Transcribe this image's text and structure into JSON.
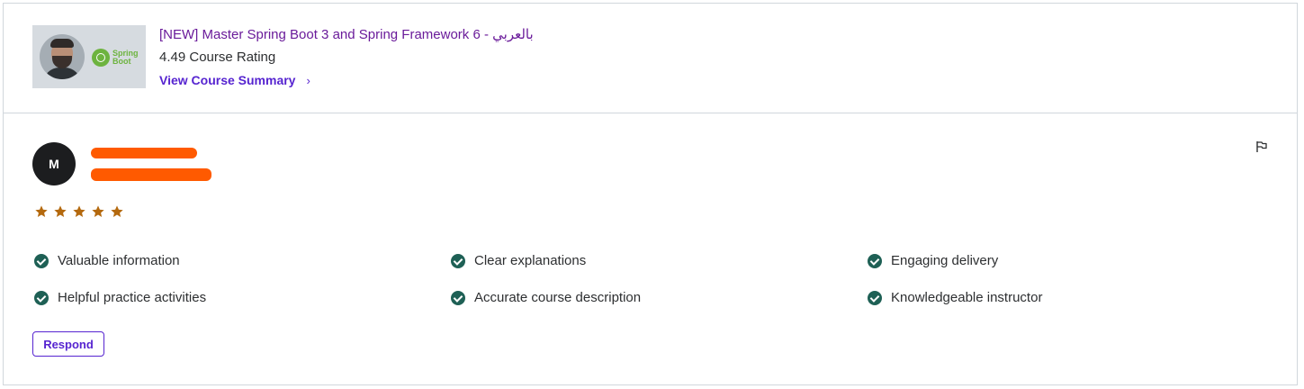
{
  "course": {
    "title": "[NEW] Master Spring Boot 3 and Spring Framework 6 - بالعربي",
    "rating_text": "4.49 Course Rating",
    "view_summary_label": "View Course Summary",
    "thumbnail_logo_line1": "Spring",
    "thumbnail_logo_line2": "Boot"
  },
  "review": {
    "avatar_initial": "M",
    "rating_stars": 5,
    "feedback_items": [
      "Valuable information",
      "Clear explanations",
      "Engaging delivery",
      "Helpful practice activities",
      "Accurate course description",
      "Knowledgeable instructor"
    ],
    "respond_label": "Respond"
  },
  "colors": {
    "accent": "#5624d0",
    "title_link": "#6a1b9a",
    "star": "#b4690e",
    "check": "#1e6055",
    "redaction": "#ff5a00"
  }
}
